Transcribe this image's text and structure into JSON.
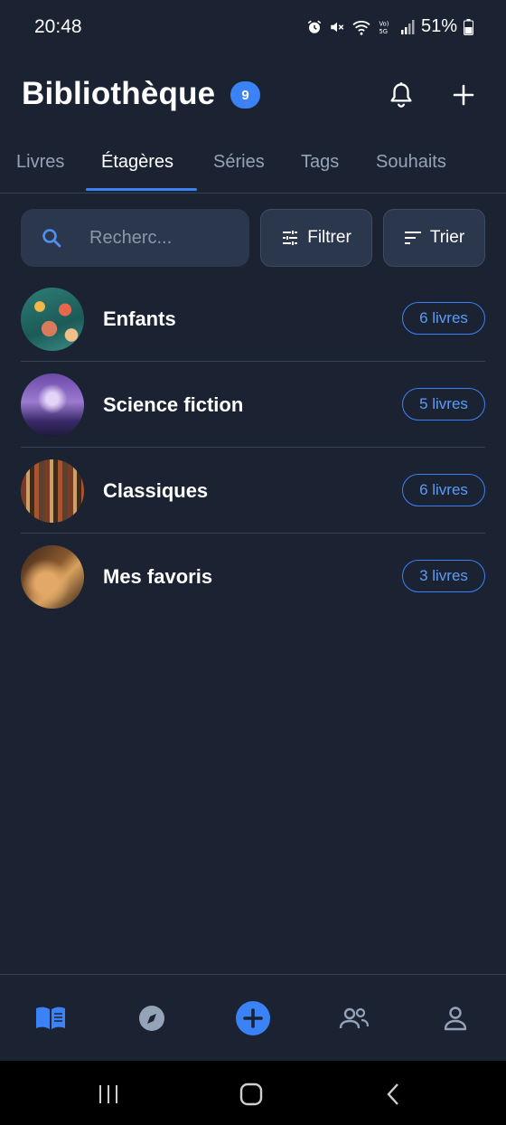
{
  "status_bar": {
    "time": "20:48",
    "battery": "51%"
  },
  "header": {
    "title": "Bibliothèque",
    "badge_count": "9"
  },
  "tabs": [
    {
      "label": "Livres",
      "active": false
    },
    {
      "label": "Étagères",
      "active": true
    },
    {
      "label": "Séries",
      "active": false
    },
    {
      "label": "Tags",
      "active": false
    },
    {
      "label": "Souhaits",
      "active": false
    }
  ],
  "search": {
    "placeholder": "Recherc..."
  },
  "toolbar": {
    "filter_label": "Filtrer",
    "sort_label": "Trier"
  },
  "shelves": [
    {
      "name": "Enfants",
      "count": "6 livres"
    },
    {
      "name": "Science fiction",
      "count": "5 livres"
    },
    {
      "name": "Classiques",
      "count": "6 livres"
    },
    {
      "name": "Mes favoris",
      "count": "3 livres"
    }
  ],
  "bottom_nav": [
    {
      "icon": "book-open-icon",
      "active": true
    },
    {
      "icon": "compass-icon",
      "active": false
    },
    {
      "icon": "plus-circle-icon",
      "active": false
    },
    {
      "icon": "users-icon",
      "active": false
    },
    {
      "icon": "user-icon",
      "active": false
    }
  ],
  "colors": {
    "background": "#1b2333",
    "accent": "#3b82f6",
    "surface": "#2b374c",
    "muted_text": "#94a3b8"
  }
}
